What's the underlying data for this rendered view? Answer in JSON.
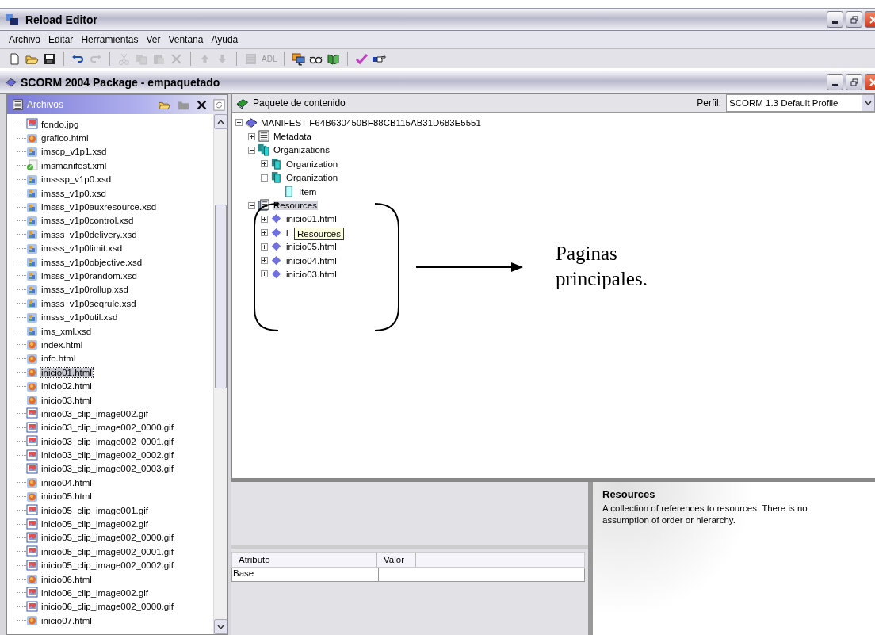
{
  "window": {
    "title": "Reload Editor"
  },
  "menu": [
    "Archivo",
    "Editar",
    "Herramientas",
    "Ver",
    "Ventana",
    "Ayuda"
  ],
  "toolbar": [
    [
      {
        "kind": "new",
        "disabled": false
      },
      {
        "kind": "open",
        "disabled": false
      },
      {
        "kind": "save",
        "disabled": false
      }
    ],
    [
      {
        "kind": "undo",
        "disabled": false
      },
      {
        "kind": "redo",
        "disabled": true
      }
    ],
    [
      {
        "kind": "cut",
        "disabled": true
      },
      {
        "kind": "copy",
        "disabled": true
      },
      {
        "kind": "paste",
        "disabled": true
      },
      {
        "kind": "delete",
        "disabled": true
      }
    ],
    [
      {
        "kind": "up",
        "disabled": true
      },
      {
        "kind": "down",
        "disabled": true
      }
    ],
    [
      {
        "kind": "list",
        "disabled": true
      },
      {
        "kind": "text",
        "label": "ADL",
        "disabled": true
      }
    ],
    [
      {
        "kind": "preview",
        "disabled": false
      },
      {
        "kind": "glasses",
        "disabled": false
      },
      {
        "kind": "book",
        "disabled": false
      }
    ],
    [
      {
        "kind": "check",
        "disabled": false
      },
      {
        "kind": "pointer",
        "disabled": false
      }
    ]
  ],
  "package": {
    "title": "SCORM 2004 Package - empaquetado"
  },
  "files": {
    "title": "Archivos",
    "items": [
      {
        "name": "fondo.jpg",
        "kind": "image",
        "selected": false
      },
      {
        "name": "grafico.html",
        "kind": "html",
        "selected": false
      },
      {
        "name": "imscp_v1p1.xsd",
        "kind": "xsd",
        "selected": false
      },
      {
        "name": "imsmanifest.xml",
        "kind": "xml",
        "selected": false
      },
      {
        "name": "imsssp_v1p0.xsd",
        "kind": "xsd",
        "selected": false
      },
      {
        "name": "imsss_v1p0.xsd",
        "kind": "xsd",
        "selected": false
      },
      {
        "name": "imsss_v1p0auxresource.xsd",
        "kind": "xsd",
        "selected": false
      },
      {
        "name": "imsss_v1p0control.xsd",
        "kind": "xsd",
        "selected": false
      },
      {
        "name": "imsss_v1p0delivery.xsd",
        "kind": "xsd",
        "selected": false
      },
      {
        "name": "imsss_v1p0limit.xsd",
        "kind": "xsd",
        "selected": false
      },
      {
        "name": "imsss_v1p0objective.xsd",
        "kind": "xsd",
        "selected": false
      },
      {
        "name": "imsss_v1p0random.xsd",
        "kind": "xsd",
        "selected": false
      },
      {
        "name": "imsss_v1p0rollup.xsd",
        "kind": "xsd",
        "selected": false
      },
      {
        "name": "imsss_v1p0seqrule.xsd",
        "kind": "xsd",
        "selected": false
      },
      {
        "name": "imsss_v1p0util.xsd",
        "kind": "xsd",
        "selected": false
      },
      {
        "name": "ims_xml.xsd",
        "kind": "xsd",
        "selected": false
      },
      {
        "name": "index.html",
        "kind": "html",
        "selected": false
      },
      {
        "name": "info.html",
        "kind": "html",
        "selected": false
      },
      {
        "name": "inicio01.html",
        "kind": "html",
        "selected": true
      },
      {
        "name": "inicio02.html",
        "kind": "html",
        "selected": false
      },
      {
        "name": "inicio03.html",
        "kind": "html",
        "selected": false
      },
      {
        "name": "inicio03_clip_image002.gif",
        "kind": "image",
        "selected": false
      },
      {
        "name": "inicio03_clip_image002_0000.gif",
        "kind": "image",
        "selected": false
      },
      {
        "name": "inicio03_clip_image002_0001.gif",
        "kind": "image",
        "selected": false
      },
      {
        "name": "inicio03_clip_image002_0002.gif",
        "kind": "image",
        "selected": false
      },
      {
        "name": "inicio03_clip_image002_0003.gif",
        "kind": "image",
        "selected": false
      },
      {
        "name": "inicio04.html",
        "kind": "html",
        "selected": false
      },
      {
        "name": "inicio05.html",
        "kind": "html",
        "selected": false
      },
      {
        "name": "inicio05_clip_image001.gif",
        "kind": "image",
        "selected": false
      },
      {
        "name": "inicio05_clip_image002.gif",
        "kind": "image",
        "selected": false
      },
      {
        "name": "inicio05_clip_image002_0000.gif",
        "kind": "image",
        "selected": false
      },
      {
        "name": "inicio05_clip_image002_0001.gif",
        "kind": "image",
        "selected": false
      },
      {
        "name": "inicio05_clip_image002_0002.gif",
        "kind": "image",
        "selected": false
      },
      {
        "name": "inicio06.html",
        "kind": "html",
        "selected": false
      },
      {
        "name": "inicio06_clip_image002.gif",
        "kind": "image",
        "selected": false
      },
      {
        "name": "inicio06_clip_image002_0000.gif",
        "kind": "image",
        "selected": false
      },
      {
        "name": "inicio07.html",
        "kind": "html",
        "selected": false
      }
    ]
  },
  "content": {
    "title": "Paquete de contenido",
    "profile_label": "Perfil:",
    "profile": "SCORM 1.3 Default Profile",
    "tree": {
      "label": "MANIFEST-F64B630450BF88CB115AB31D683E5551",
      "kind": "manifest",
      "expanded": true,
      "selected": false,
      "children": [
        {
          "label": "Metadata",
          "kind": "metadata",
          "expanded": false,
          "selected": false
        },
        {
          "label": "Organizations",
          "kind": "organizations",
          "expanded": true,
          "selected": false,
          "children": [
            {
              "label": "Organization",
              "kind": "organization",
              "expanded": false,
              "selected": false
            },
            {
              "label": "Organization",
              "kind": "organization",
              "expanded": true,
              "selected": false,
              "children": [
                {
                  "label": "Item",
                  "kind": "item",
                  "selected": false
                }
              ]
            }
          ]
        },
        {
          "label": "Resources",
          "kind": "resources",
          "expanded": true,
          "selected": true,
          "children": [
            {
              "label": "inicio01.html",
              "kind": "resource",
              "expanded": false,
              "selected": false
            },
            {
              "label": "i",
              "kind": "resource",
              "expanded": false,
              "selected": false
            },
            {
              "label": "inicio05.html",
              "kind": "resource",
              "expanded": false,
              "selected": false
            },
            {
              "label": "inicio04.html",
              "kind": "resource",
              "expanded": false,
              "selected": false
            },
            {
              "label": "inicio03.html",
              "kind": "resource",
              "expanded": false,
              "selected": false
            }
          ]
        }
      ]
    },
    "tooltip": "Resources",
    "annotation": "Paginas principales."
  },
  "attributes": {
    "columns": [
      "Atributo",
      "Valor"
    ],
    "rows": [
      {
        "attribute": "Base"
      }
    ]
  },
  "info": {
    "title": "Resources",
    "text": "A collection of references to resources. There is no assumption of order or hierarchy."
  }
}
